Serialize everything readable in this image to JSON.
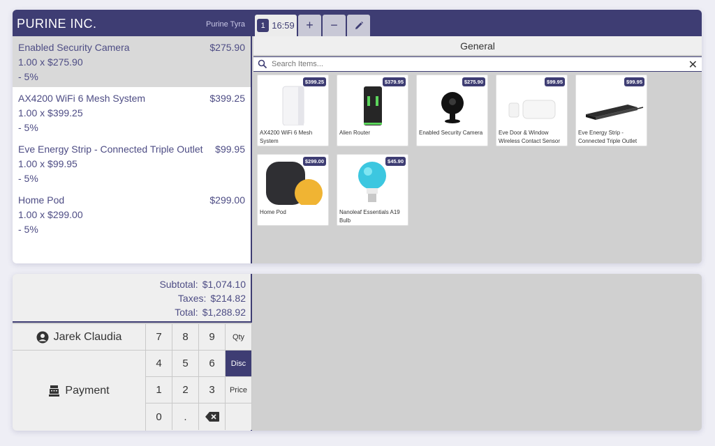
{
  "header": {
    "brand": "PURINE INC.",
    "cashier": "Purine Tyra",
    "tabs": [
      {
        "number": "1",
        "time": "16:59"
      },
      {
        "label": "+"
      },
      {
        "label": "−"
      }
    ]
  },
  "order": {
    "lines": [
      {
        "name": "Enabled Security Camera",
        "price": "$275.90",
        "qty": "1.00 x $275.90",
        "discount": "- 5%",
        "selected": true
      },
      {
        "name": "AX4200 WiFi 6 Mesh System",
        "price": "$399.25",
        "qty": "1.00 x $399.25",
        "discount": "- 5%"
      },
      {
        "name": "Eve Energy Strip - Connected Triple Outlet",
        "price": "$99.95",
        "qty": "1.00 x $99.95",
        "discount": "- 5%"
      },
      {
        "name": "Home Pod",
        "price": "$299.00",
        "qty": "1.00 x $299.00",
        "discount": "- 5%"
      }
    ]
  },
  "catalog": {
    "category": "General",
    "search_placeholder": "Search Items...",
    "products": [
      {
        "name": "AX4200 WiFi 6 Mesh System",
        "price": "$399.25"
      },
      {
        "name": "Alien Router",
        "price": "$379.95"
      },
      {
        "name": "Enabled Security Camera",
        "price": "$275.90"
      },
      {
        "name": "Eve Door & Window Wireless Contact Sensor",
        "price": "$99.95"
      },
      {
        "name": "Eve Energy Strip - Connected Triple Outlet",
        "price": "$99.95"
      },
      {
        "name": "Home Pod",
        "price": "$299.00"
      },
      {
        "name": "Nanoleaf Essentials A19 Bulb",
        "price": "$45.90"
      }
    ]
  },
  "totals": {
    "subtotal_label": "Subtotal:",
    "subtotal": "$1,074.10",
    "taxes_label": "Taxes:",
    "taxes": "$214.82",
    "total_label": "Total:",
    "total": "$1,288.92"
  },
  "controls": {
    "customer": "Jarek Claudia",
    "payment": "Payment",
    "keys": [
      "7",
      "8",
      "9",
      "4",
      "5",
      "6",
      "1",
      "2",
      "3",
      "0",
      "."
    ],
    "modes": [
      "Qty",
      "Disc",
      "Price"
    ],
    "active_mode": "Disc"
  },
  "colors": {
    "accent": "#3e3d73",
    "panel_gray": "#d0d0d0"
  }
}
